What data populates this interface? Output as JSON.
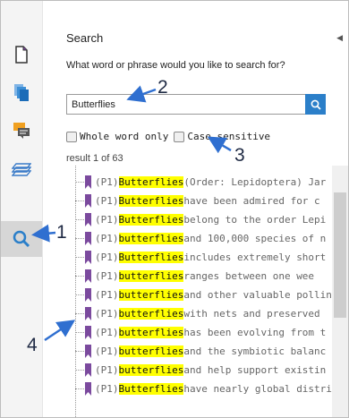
{
  "panel": {
    "title": "Search",
    "prompt": "What word or phrase would you like to search for?",
    "search_value": "Butterflies",
    "whole_word_label": "Whole word only",
    "case_sensitive_label": "Case sensitive",
    "result_count": "result 1 of 63"
  },
  "results": [
    {
      "prefix": "(P1) ",
      "match": "Butterflies",
      "rest": " (Order: Lepidoptera) Jar"
    },
    {
      "prefix": "(P1) ",
      "match": "Butterflies",
      "rest": " have been admired for c"
    },
    {
      "prefix": "(P1) ",
      "match": "Butterflies",
      "rest": " belong to the order Lepi"
    },
    {
      "prefix": "(P1) ",
      "match": "butterflies",
      "rest": " and 100,000 species of n"
    },
    {
      "prefix": "(P1) ",
      "match": "Butterflies",
      "rest": " includes extremely short"
    },
    {
      "prefix": "(P1) ",
      "match": "butterflies",
      "rest": " ranges between one wee"
    },
    {
      "prefix": "(P1) ",
      "match": "butterflies",
      "rest": " and other valuable pollin"
    },
    {
      "prefix": "(P1) ",
      "match": "butterflies",
      "rest": " with nets and preserved"
    },
    {
      "prefix": "(P1) ",
      "match": "butterflies",
      "rest": " has been evolving from t"
    },
    {
      "prefix": "(P1) ",
      "match": "butterflies",
      "rest": " and the symbiotic balanc"
    },
    {
      "prefix": "(P1) ",
      "match": "butterflies",
      "rest": " and help support existin"
    },
    {
      "prefix": "(P1) ",
      "match": "Butterflies",
      "rest": " have nearly global distri"
    }
  ],
  "callouts": [
    "1",
    "2",
    "3",
    "4"
  ],
  "colors": {
    "accent": "#2b7fc9",
    "highlight": "#ffff00",
    "bookmark": "#7b4a9e",
    "annotation": "#2f6fd0"
  },
  "icons": [
    "page-icon",
    "pages-icon",
    "comments-icon",
    "layers-icon",
    "search-icon",
    "collapse-arrow-icon",
    "bookmark-icon"
  ]
}
